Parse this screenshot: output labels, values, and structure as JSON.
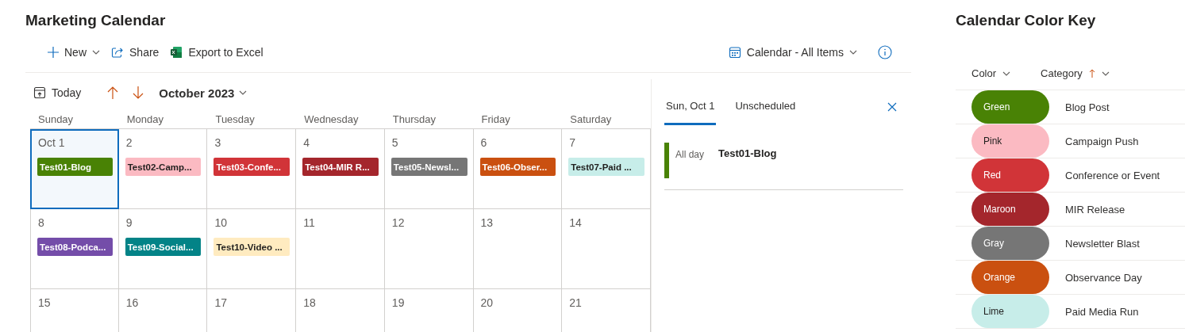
{
  "page": {
    "title": "Marketing Calendar"
  },
  "toolbar": {
    "commands": [
      {
        "kind": "new",
        "label": "New"
      },
      {
        "kind": "share",
        "label": "Share"
      },
      {
        "kind": "excel",
        "label": "Export to Excel"
      }
    ],
    "view": "Calendar - All Items"
  },
  "calendar": {
    "today": "Today",
    "month": "October 2023",
    "weekdays": [
      "Sunday",
      "Monday",
      "Tuesday",
      "Wednesday",
      "Thursday",
      "Friday",
      "Saturday"
    ],
    "weeks": [
      [
        {
          "label": "Oct 1",
          "selected": true,
          "events": [
            {
              "title": "Test01-Blog",
              "color": "#498205"
            }
          ]
        },
        {
          "label": "2",
          "selected": false,
          "events": [
            {
              "title": "Test02-Camp...",
              "color": "#fbbac2"
            }
          ]
        },
        {
          "label": "3",
          "selected": false,
          "events": [
            {
              "title": "Test03-Confe...",
              "color": "#d13438"
            }
          ]
        },
        {
          "label": "4",
          "selected": false,
          "events": [
            {
              "title": "Test04-MIR R...",
              "color": "#a4262c"
            }
          ]
        },
        {
          "label": "5",
          "selected": false,
          "events": [
            {
              "title": "Test05-Newsl...",
              "color": "#767676"
            }
          ]
        },
        {
          "label": "6",
          "selected": false,
          "events": [
            {
              "title": "Test06-Obser...",
              "color": "#ca5010"
            }
          ]
        },
        {
          "label": "7",
          "selected": false,
          "events": [
            {
              "title": "Test07-Paid ...",
              "color": "#c7ede9"
            }
          ]
        }
      ],
      [
        {
          "label": "8",
          "selected": false,
          "events": [
            {
              "title": "Test08-Podca...",
              "color": "#744da9"
            }
          ]
        },
        {
          "label": "9",
          "selected": false,
          "events": [
            {
              "title": "Test09-Social...",
              "color": "#038387"
            }
          ]
        },
        {
          "label": "10",
          "selected": false,
          "events": [
            {
              "title": "Test10-Video ...",
              "color": "#ffebc0"
            }
          ]
        },
        {
          "label": "11",
          "selected": false
        },
        {
          "label": "12",
          "selected": false
        },
        {
          "label": "13",
          "selected": false
        },
        {
          "label": "14",
          "selected": false
        }
      ],
      [
        {
          "label": "15",
          "selected": false
        },
        {
          "label": "16",
          "selected": false
        },
        {
          "label": "17",
          "selected": false
        },
        {
          "label": "18",
          "selected": false
        },
        {
          "label": "19",
          "selected": false
        },
        {
          "label": "20",
          "selected": false
        },
        {
          "label": "21",
          "selected": false
        }
      ]
    ]
  },
  "day_panel": {
    "tabs": [
      {
        "label": "Sun, Oct 1",
        "selected": true
      },
      {
        "label": "Unscheduled",
        "selected": false
      }
    ],
    "items": [
      {
        "time": "All day",
        "title": "Test01-Blog",
        "color": "#498205"
      }
    ]
  },
  "color_key": {
    "title": "Calendar Color Key",
    "columns": [
      {
        "label": "Color",
        "sorted": false
      },
      {
        "label": "Category",
        "sorted": true
      }
    ],
    "rows": [
      {
        "color_name": "Green",
        "color": "#498205",
        "category": "Blog Post"
      },
      {
        "color_name": "Pink",
        "color": "#fbbac2",
        "category": "Campaign Push"
      },
      {
        "color_name": "Red",
        "color": "#d13438",
        "category": "Conference or Event"
      },
      {
        "color_name": "Maroon",
        "color": "#a4262c",
        "category": "MIR Release"
      },
      {
        "color_name": "Gray",
        "color": "#767676",
        "category": "Newsletter Blast"
      },
      {
        "color_name": "Orange",
        "color": "#ca5010",
        "category": "Observance Day"
      },
      {
        "color_name": "Lime",
        "color": "#c7ede9",
        "category": "Paid Media Run"
      }
    ]
  }
}
